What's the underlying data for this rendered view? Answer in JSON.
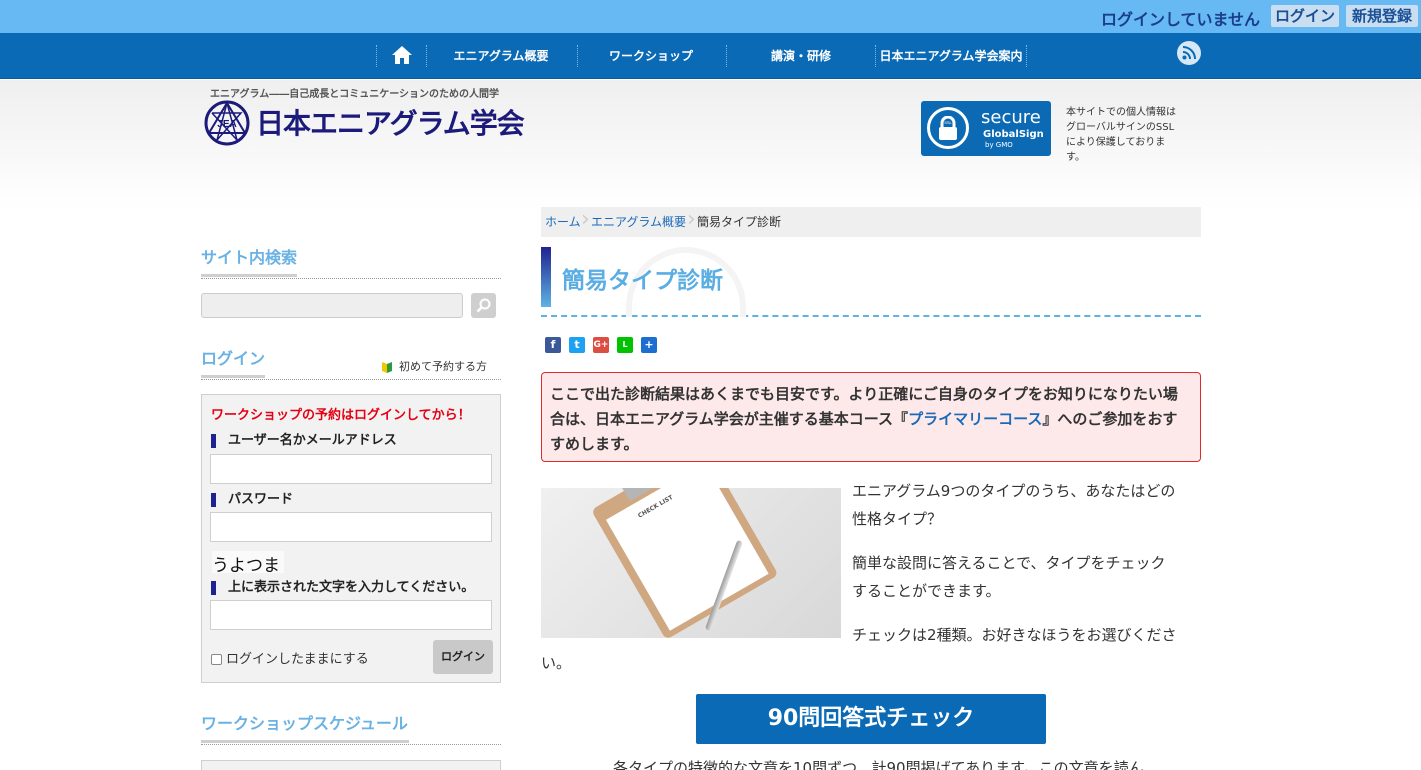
{
  "topbar": {
    "status": "ログインしていません",
    "login": "ログイン",
    "register": "新規登録"
  },
  "nav": {
    "items": [
      "エニアグラム概要",
      "ワークショップ",
      "講演・研修",
      "日本エニアグラム学会案内"
    ],
    "icons": [
      "home-icon",
      "rss-icon"
    ]
  },
  "header": {
    "tagline": "エニアグラム――自己成長とコミュニケーションのための人間学",
    "logo_text": "日本エニアグラム学会",
    "logo_mark": "JEA",
    "ssl_line1": "secure",
    "ssl_line2": "GlobalSign",
    "ssl_line3": "by GMO",
    "ssl_badge_small": "SSL",
    "ssl_note": "本サイトでの個人情報はグローバルサインのSSLにより保護しております。"
  },
  "sidebar": {
    "search_title": "サイト内検索",
    "login_title": "ログイン",
    "first_time_link": "初めて予約する方",
    "login_notice": "ワークショップの予約はログインしてから！",
    "username_label": "ユーザー名かメールアドレス",
    "password_label": "パスワード",
    "captcha_text": "うよつま",
    "captcha_label": "上に表示された文字を入力してください。",
    "remember_label": "ログインしたままにする",
    "login_button": "ログイン",
    "schedule_title": "ワークショップスケジュール"
  },
  "breadcrumb": {
    "home": "ホーム",
    "parent": "エニアグラム概要",
    "current": "簡易タイプ診断"
  },
  "main": {
    "title": "簡易タイプ診断",
    "share_icons": [
      "facebook-icon",
      "twitter-icon",
      "googleplus-icon",
      "line-icon",
      "share-icon"
    ],
    "notice_part1": "ここで出た診断結果はあくまでも目安です。より正確にご自身のタイプをお知りになりたい場合は、日本エニアグラム学会が主催する基本コース『",
    "notice_link": "プライマリーコース",
    "notice_part2": "』へのご参加をおすすめします。",
    "image_caption": "CHECK LIST",
    "para1_line1": "エニアグラム9つのタイプのうち、あなたはどの",
    "para1_line2": "性格タイプ？",
    "para2_line1": "簡単な設問に答えることで、タイプをチェック",
    "para2_line2": "することができます。",
    "para3_line1": "チェックは2種類。お好きなほうをお選びくださ",
    "para3_line2": "い。",
    "cta_button": "90問回答式チェック",
    "cut_text": "各タイプの特徴的な文章を10問ずつ、計90問掲げてあります。この文章を読ん"
  },
  "colors": {
    "topbar": "#66b9f2",
    "nav": "#0a6ab5",
    "accent_blue": "#5aaee3",
    "notice_border": "#e02b2b",
    "login_notice": "#e60012"
  }
}
